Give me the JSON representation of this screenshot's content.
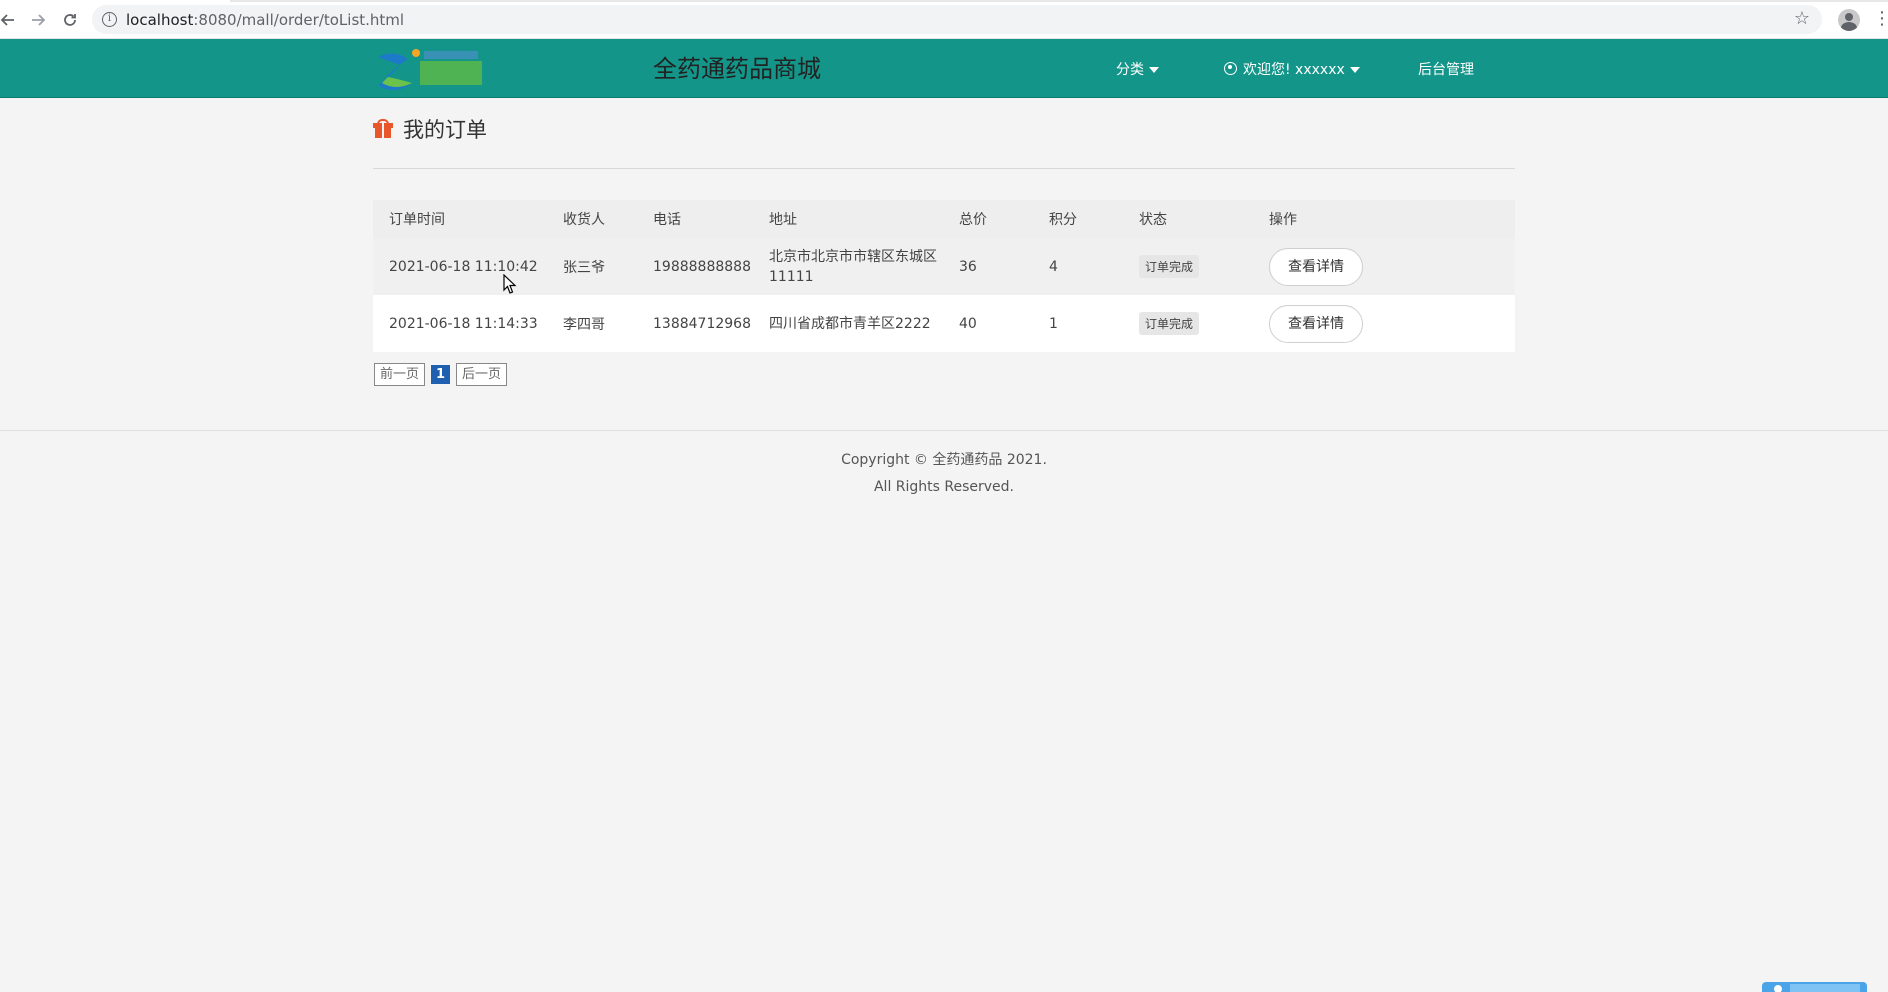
{
  "browser": {
    "url_host": "localhost",
    "url_rest": ":8080/mall/order/toList.html",
    "back_icon": "arrow-left-icon",
    "forward_icon": "arrow-right-icon",
    "reload_icon": "reload-icon",
    "info_icon": "info-icon",
    "bookmark_icon": "star-icon",
    "profile_icon": "profile-icon",
    "menu_icon": "more-vert-icon"
  },
  "header": {
    "site_title": "全药通药品商城",
    "category_label": "分类",
    "welcome_label": "欢迎您! xxxxxx",
    "admin_label": "后台管理",
    "accent_color": "#139689"
  },
  "page": {
    "title": "我的订单",
    "icon": "gift-icon"
  },
  "table": {
    "headers": [
      "订单时间",
      "收货人",
      "电话",
      "地址",
      "总价",
      "积分",
      "状态",
      "操作"
    ],
    "rows": [
      {
        "time": "2021-06-18 11:10:42",
        "receiver": "张三爷",
        "phone": "19888888888",
        "address": "北京市北京市市辖区东城区11111",
        "total": "36",
        "points": "4",
        "status": "订单完成",
        "action": "查看详情"
      },
      {
        "time": "2021-06-18 11:14:33",
        "receiver": "李四哥",
        "phone": "13884712968",
        "address": "四川省成都市青羊区2222",
        "total": "40",
        "points": "1",
        "status": "订单完成",
        "action": "查看详情"
      }
    ]
  },
  "pagination": {
    "prev_label": "前一页",
    "current_page": "1",
    "next_label": "后一页"
  },
  "footer": {
    "copyright": "Copyright © 全药通药品 2021.",
    "rights": "All Rights Reserved."
  }
}
